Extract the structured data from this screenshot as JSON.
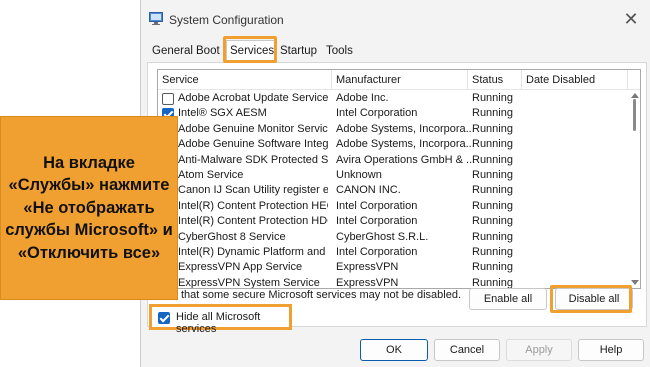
{
  "window": {
    "title": "System Configuration",
    "close_glyph": "✕"
  },
  "tabs": [
    "General",
    "Boot",
    "Services",
    "Startup",
    "Tools"
  ],
  "active_tab": "Services",
  "columns": [
    "Service",
    "Manufacturer",
    "Status",
    "Date Disabled"
  ],
  "services": [
    {
      "name": "Adobe Acrobat Update Service",
      "manufacturer": "Adobe Inc.",
      "status": "Running",
      "checked": false,
      "checkbox_visible": true
    },
    {
      "name": "Intel® SGX AESM",
      "manufacturer": "Intel Corporation",
      "status": "Running",
      "checked": true,
      "checkbox_visible": true
    },
    {
      "name": "Adobe Genuine Monitor Service",
      "manufacturer": "Adobe Systems, Incorpora...",
      "status": "Running"
    },
    {
      "name": "Adobe Genuine Software Integri...",
      "manufacturer": "Adobe Systems, Incorpora...",
      "status": "Running"
    },
    {
      "name": "Anti-Malware SDK Protected Ser...",
      "manufacturer": "Avira Operations GmbH & ...",
      "status": "Running"
    },
    {
      "name": "Atom Service",
      "manufacturer": "Unknown",
      "status": "Running"
    },
    {
      "name": "Canon IJ Scan Utility register ev...",
      "manufacturer": "CANON INC.",
      "status": "Running"
    },
    {
      "name": "Intel(R) Content Protection HECI...",
      "manufacturer": "Intel Corporation",
      "status": "Running"
    },
    {
      "name": "Intel(R) Content Protection HDC...",
      "manufacturer": "Intel Corporation",
      "status": "Running"
    },
    {
      "name": "CyberGhost 8 Service",
      "manufacturer": "CyberGhost S.R.L.",
      "status": "Running"
    },
    {
      "name": "Intel(R) Dynamic Platform and T...",
      "manufacturer": "Intel Corporation",
      "status": "Running"
    },
    {
      "name": "ExpressVPN App Service",
      "manufacturer": "ExpressVPN",
      "status": "Running"
    },
    {
      "name": "ExpressVPN System Service",
      "manufacturer": "ExpressVPN",
      "status": "Running"
    }
  ],
  "note": "that some secure Microsoft services may not be disabled.",
  "buttons": {
    "enable_all": "Enable all",
    "disable_all": "Disable all",
    "ok": "OK",
    "cancel": "Cancel",
    "apply": "Apply",
    "help": "Help"
  },
  "hide_ms": {
    "label": "Hide all Microsoft services",
    "checked": true
  },
  "callout": {
    "text": "На вкладке «Службы» нажмите «Не отображать службы Microsoft» и «Отключить все»"
  },
  "colors": {
    "accent": "#f0a030",
    "checkbox_blue": "#1665c4"
  }
}
